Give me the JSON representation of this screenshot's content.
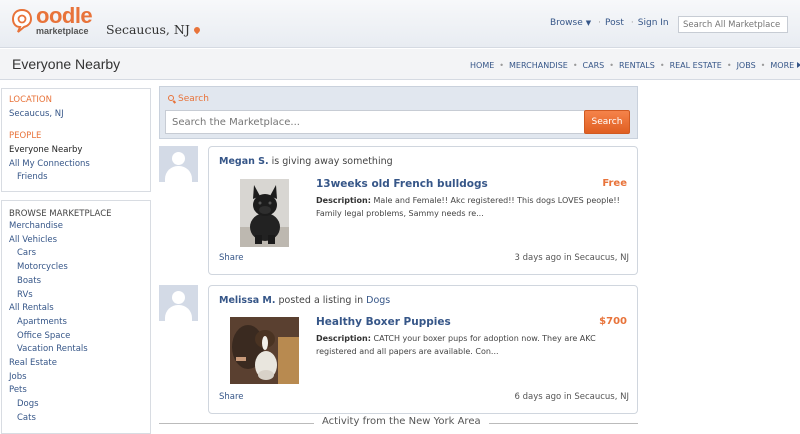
{
  "header": {
    "brand": "oodle",
    "brand_sub": "marketplace",
    "location": "Secaucus, NJ",
    "nav": [
      "Browse",
      "Post",
      "Sign In"
    ],
    "search_placeholder": "Search All Marketplace"
  },
  "titlebar": {
    "title": "Everyone Nearby",
    "nav": [
      "HOME",
      "MERCHANDISE",
      "CARS",
      "RENTALS",
      "REAL ESTATE",
      "JOBS",
      "MORE"
    ]
  },
  "sidebar": {
    "location_head": "LOCATION",
    "location_value": "Secaucus, NJ",
    "people_head": "PEOPLE",
    "people": [
      {
        "label": "Everyone Nearby",
        "current": true,
        "sub": false
      },
      {
        "label": "All My Connections",
        "current": false,
        "sub": false
      },
      {
        "label": "Friends",
        "current": false,
        "sub": true
      }
    ],
    "browse_head": "BROWSE MARKETPLACE",
    "browse": [
      {
        "label": "Merchandise",
        "sub": false
      },
      {
        "label": "All Vehicles",
        "sub": false
      },
      {
        "label": "Cars",
        "sub": true
      },
      {
        "label": "Motorcycles",
        "sub": true
      },
      {
        "label": "Boats",
        "sub": true
      },
      {
        "label": "RVs",
        "sub": true
      },
      {
        "label": "All Rentals",
        "sub": false
      },
      {
        "label": "Apartments",
        "sub": true
      },
      {
        "label": "Office Space",
        "sub": true
      },
      {
        "label": "Vacation Rentals",
        "sub": true
      },
      {
        "label": "Real Estate",
        "sub": false
      },
      {
        "label": "Jobs",
        "sub": false
      },
      {
        "label": "Pets",
        "sub": false
      },
      {
        "label": "Dogs",
        "sub": true
      },
      {
        "label": "Cats",
        "sub": true
      }
    ]
  },
  "search": {
    "label": "Search",
    "placeholder": "Search the Marketplace...",
    "button": "Search"
  },
  "feed": [
    {
      "user": "Megan S.",
      "action": "is giving away something",
      "category": "",
      "title": "13weeks old French bulldogs",
      "price": "Free",
      "desc_label": "Description:",
      "desc": "Male and Female!! Akc registered!! This dogs LOVES people!! Family legal problems, Sammy needs re...",
      "share": "Share",
      "meta": "3 days ago in Secaucus, NJ"
    },
    {
      "user": "Melissa M.",
      "action": "posted a listing in",
      "category": "Dogs",
      "title": "Healthy Boxer Puppies",
      "price": "$700",
      "desc_label": "Description:",
      "desc": "CATCH your boxer pups for adoption now. They are AKC registered and all papers are available. Con...",
      "share": "Share",
      "meta": "6 days ago in Secaucus, NJ"
    }
  ],
  "activity_divider": "Activity from the New York Area",
  "colors": {
    "accent": "#e8733a",
    "link": "#365688"
  }
}
